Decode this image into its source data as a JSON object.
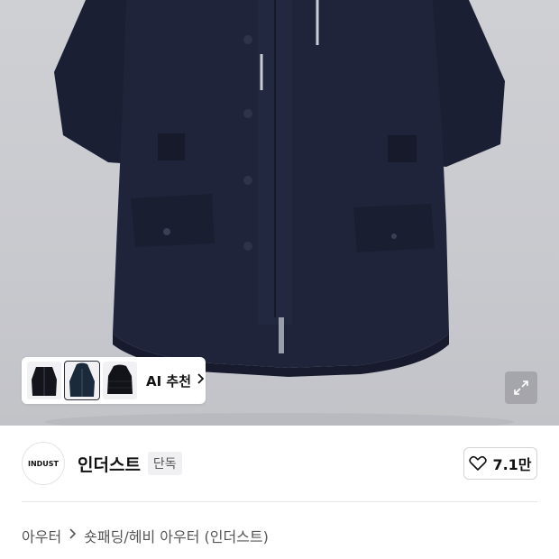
{
  "hero": {
    "ai_label": "AI 추천",
    "thumbnails": [
      "thumb-black-jacket",
      "thumb-navy-parka",
      "thumb-black-puffer"
    ],
    "expand_icon": "expand-icon"
  },
  "brand": {
    "logo_text": "INDUST",
    "name": "인더스트",
    "badge": "단독"
  },
  "like": {
    "icon": "heart-icon",
    "count": "7.1만"
  },
  "breadcrumb": {
    "items": [
      "아우터",
      "숏패딩/헤비 아우터 (인더스트)"
    ],
    "separator_icon": "chevron-right-icon"
  },
  "colors": {
    "jacket": "#1c2136",
    "background": "#c9cacf",
    "accent": "#111111"
  }
}
